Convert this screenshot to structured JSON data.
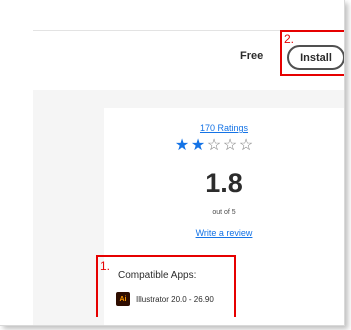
{
  "listing": {
    "price": "Free",
    "install_label": "Install"
  },
  "rating": {
    "count_label": "170 Ratings",
    "score": "1.8",
    "out_of": "out of 5",
    "stars_filled": 2,
    "stars_total": 5,
    "star_filled_glyph": "★",
    "star_empty_glyph": "☆",
    "review_link": "Write a review"
  },
  "compatibility": {
    "title": "Compatible Apps:",
    "apps": [
      {
        "icon_text": "Ai",
        "icon": "illustrator-icon",
        "label": "Illustrator 20.0 - 26.90"
      }
    ]
  },
  "annotations": {
    "install_number": "2.",
    "compat_number": "1."
  },
  "colors": {
    "accent": "#1473e6",
    "callout": "#e60000",
    "illustrator_bg": "#2e0d00",
    "illustrator_fg": "#ff9a00"
  }
}
